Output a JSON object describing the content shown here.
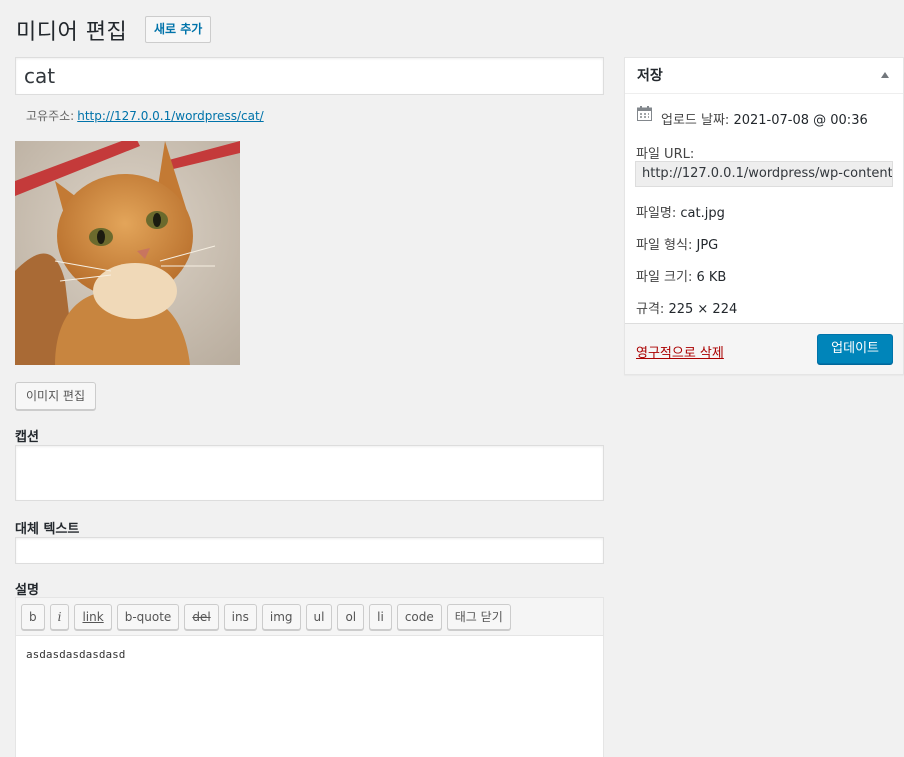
{
  "header": {
    "title": "미디어 편집",
    "add_new_label": "새로 추가"
  },
  "attachment": {
    "title": "cat",
    "permalink_label": "고유주소:",
    "permalink_url": "http://127.0.0.1/wordpress/cat/",
    "edit_image_label": "이미지 편집"
  },
  "fields": {
    "caption_label": "캡션",
    "caption_value": "",
    "alt_label": "대체 텍스트",
    "alt_value": "",
    "description_label": "설명",
    "description_value": "asdasdasdasdasd"
  },
  "quicktags": [
    "b",
    "i",
    "link",
    "b-quote",
    "del",
    "ins",
    "img",
    "ul",
    "ol",
    "li",
    "code",
    "태그 닫기"
  ],
  "sidebar": {
    "title": "저장",
    "upload_date_label": "업로드 날짜:",
    "upload_date_value": "2021-07-08 @ 00:36",
    "file_url_label": "파일 URL:",
    "file_url_value": "http://127.0.0.1/wordpress/wp-content/",
    "file_name_label": "파일명:",
    "file_name_value": "cat.jpg",
    "file_type_label": "파일 형식:",
    "file_type_value": "JPG",
    "file_size_label": "파일 크기:",
    "file_size_value": "6 KB",
    "dimensions_label": "규격:",
    "dimensions_value": "225 × 224",
    "delete_label": "영구적으로 삭제",
    "update_label": "업데이트"
  },
  "colors": {
    "accent": "#0073aa",
    "primary_button": "#0085ba",
    "delete": "#aa0000",
    "background": "#f1f1f1"
  }
}
